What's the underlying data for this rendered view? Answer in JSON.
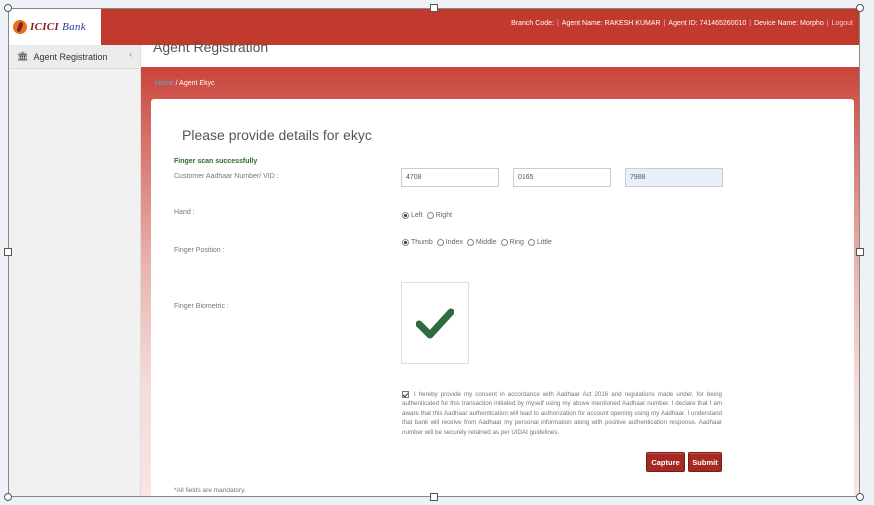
{
  "header": {
    "brand_name": "ICICI",
    "brand_suffix": "Bank",
    "branch_code_label": "Branch Code:",
    "agent_name_label": "Agent Name: RAKESH KUMAR",
    "agent_id_label": "Agent ID: 741465260010",
    "device_name_label": "Device Name: Morpho",
    "logout_label": "Logout"
  },
  "sidebar": {
    "items": [
      {
        "label": "Agent Registration",
        "icon": "bank-icon"
      }
    ],
    "collapse_icon": "‹"
  },
  "page": {
    "heading": "Agent Registration",
    "breadcrumb": {
      "link": "Home",
      "separator": "/",
      "current": "Agent Ekyc"
    }
  },
  "form": {
    "title": "Please provide details for ekyc",
    "success_message": "Finger scan successfully",
    "aadhaar_label": "Customer Aadhaar Number/ VID :",
    "aadhaar_parts": [
      "4708",
      "0165",
      "7988"
    ],
    "hand_label": "Hand :",
    "hand_options": [
      "Left",
      "Right"
    ],
    "hand_selected": "Left",
    "finger_position_label": "Finger Position :",
    "finger_options": [
      "Thumb",
      "Index",
      "Middle",
      "Ring",
      "Little"
    ],
    "finger_selected": "Thumb",
    "finger_biometric_label": "Finger Biometric :",
    "biometric_status_icon": "checkmark-icon",
    "consent_checked": true,
    "consent_text": "I hereby provide my consent in accordance with Aadhaar Act 2016 and regulations made under, for being authenticated for this transaction initiated by myself using my above mentioned Aadhaar number. I declare that I am aware that this Aadhaar authentication will lead to authorization for account opening using my Aadhaar. I understand that bank will receive from Aadhaar my personal information along with positive authentication response. Aadhaar number will be securely retained as per UIDAI guidelines.",
    "capture_label": "Capture",
    "submit_label": "Submit",
    "mandatory_note": "*All fields are mandatory."
  },
  "colors": {
    "brand_red": "#c2392d",
    "button_red": "#a52a24",
    "check_green": "#2e6b3e",
    "success_green": "#2d6b2d"
  }
}
